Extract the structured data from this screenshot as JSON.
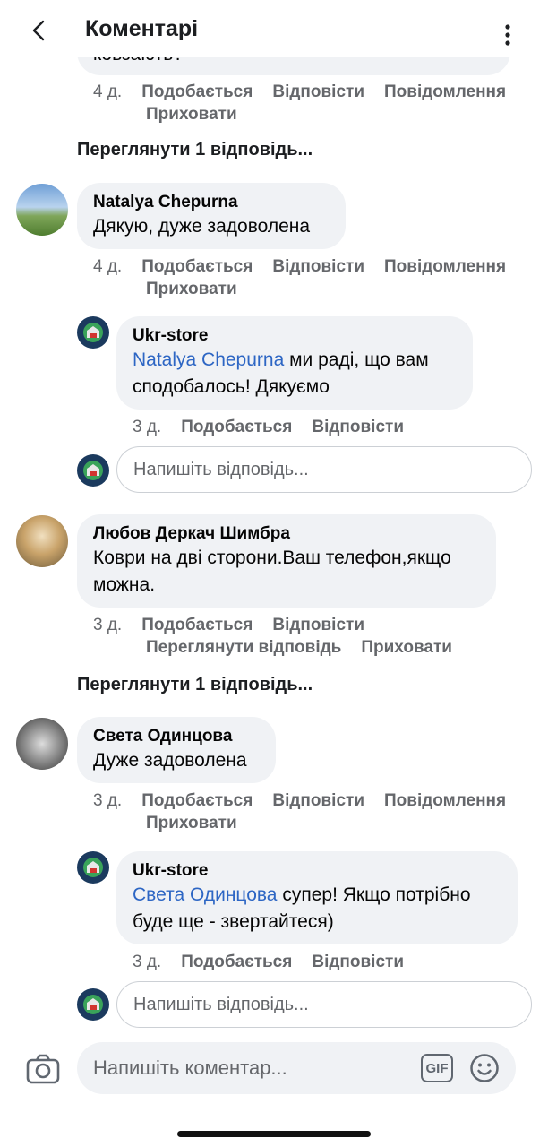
{
  "header": {
    "title": "Коментарі"
  },
  "top_comment": {
    "text_partial": "ковзають?",
    "time": "4 д.",
    "like": "Подобається",
    "reply": "Відповісти",
    "report": "Повідомлення",
    "hide": "Приховати"
  },
  "view_replies_1": "Переглянути 1 відповідь...",
  "comment_natalya": {
    "name": "Natalya  Chepurna",
    "text": "Дякую, дуже задоволена",
    "time": "4 д.",
    "like": "Подобається",
    "reply": "Відповісти",
    "report": "Повідомлення",
    "hide": "Приховати"
  },
  "reply_store_1": {
    "name": "Ukr-store",
    "mention": "Natalya  Chepurna",
    "text_line1": " ми раді, що вам",
    "text_line2": "сподобалось! Дякуємо",
    "time": "3 д.",
    "like": "Подобається",
    "reply": "Відповісти"
  },
  "reply_input_1": {
    "placeholder": "Напишіть відповідь..."
  },
  "comment_lyubov": {
    "name": "Любов Деркач Шимбра",
    "text_line1": "Коври на дві сторони.Ваш телефон,якщо",
    "text_line2": "можна.",
    "time": "3 д.",
    "like": "Подобається",
    "reply": "Відповісти",
    "view_reply": "Переглянути відповідь",
    "hide": "Приховати"
  },
  "view_replies_2": "Переглянути 1 відповідь...",
  "comment_sveta": {
    "name": "Света Одинцова",
    "text": "Дуже задоволена",
    "time": "3 д.",
    "like": "Подобається",
    "reply": "Відповісти",
    "report": "Повідомлення",
    "hide": "Приховати"
  },
  "reply_store_2": {
    "name": "Ukr-store",
    "mention": "Света Одинцова",
    "text_line1": " супер! Якщо потрібно",
    "text_line2": "буде ще - звертайтеся)",
    "time": "3 д.",
    "like": "Подобається",
    "reply": "Відповісти"
  },
  "reply_input_2": {
    "placeholder": "Напишіть відповідь..."
  },
  "composer": {
    "placeholder": "Напишіть коментар...",
    "gif_label": "GIF",
    "icons": [
      "camera-icon",
      "gif-icon",
      "emoji-icon"
    ]
  },
  "colors": {
    "mention": "#2d66c4",
    "bubble": "#f0f2f5",
    "meta": "#65676b"
  }
}
